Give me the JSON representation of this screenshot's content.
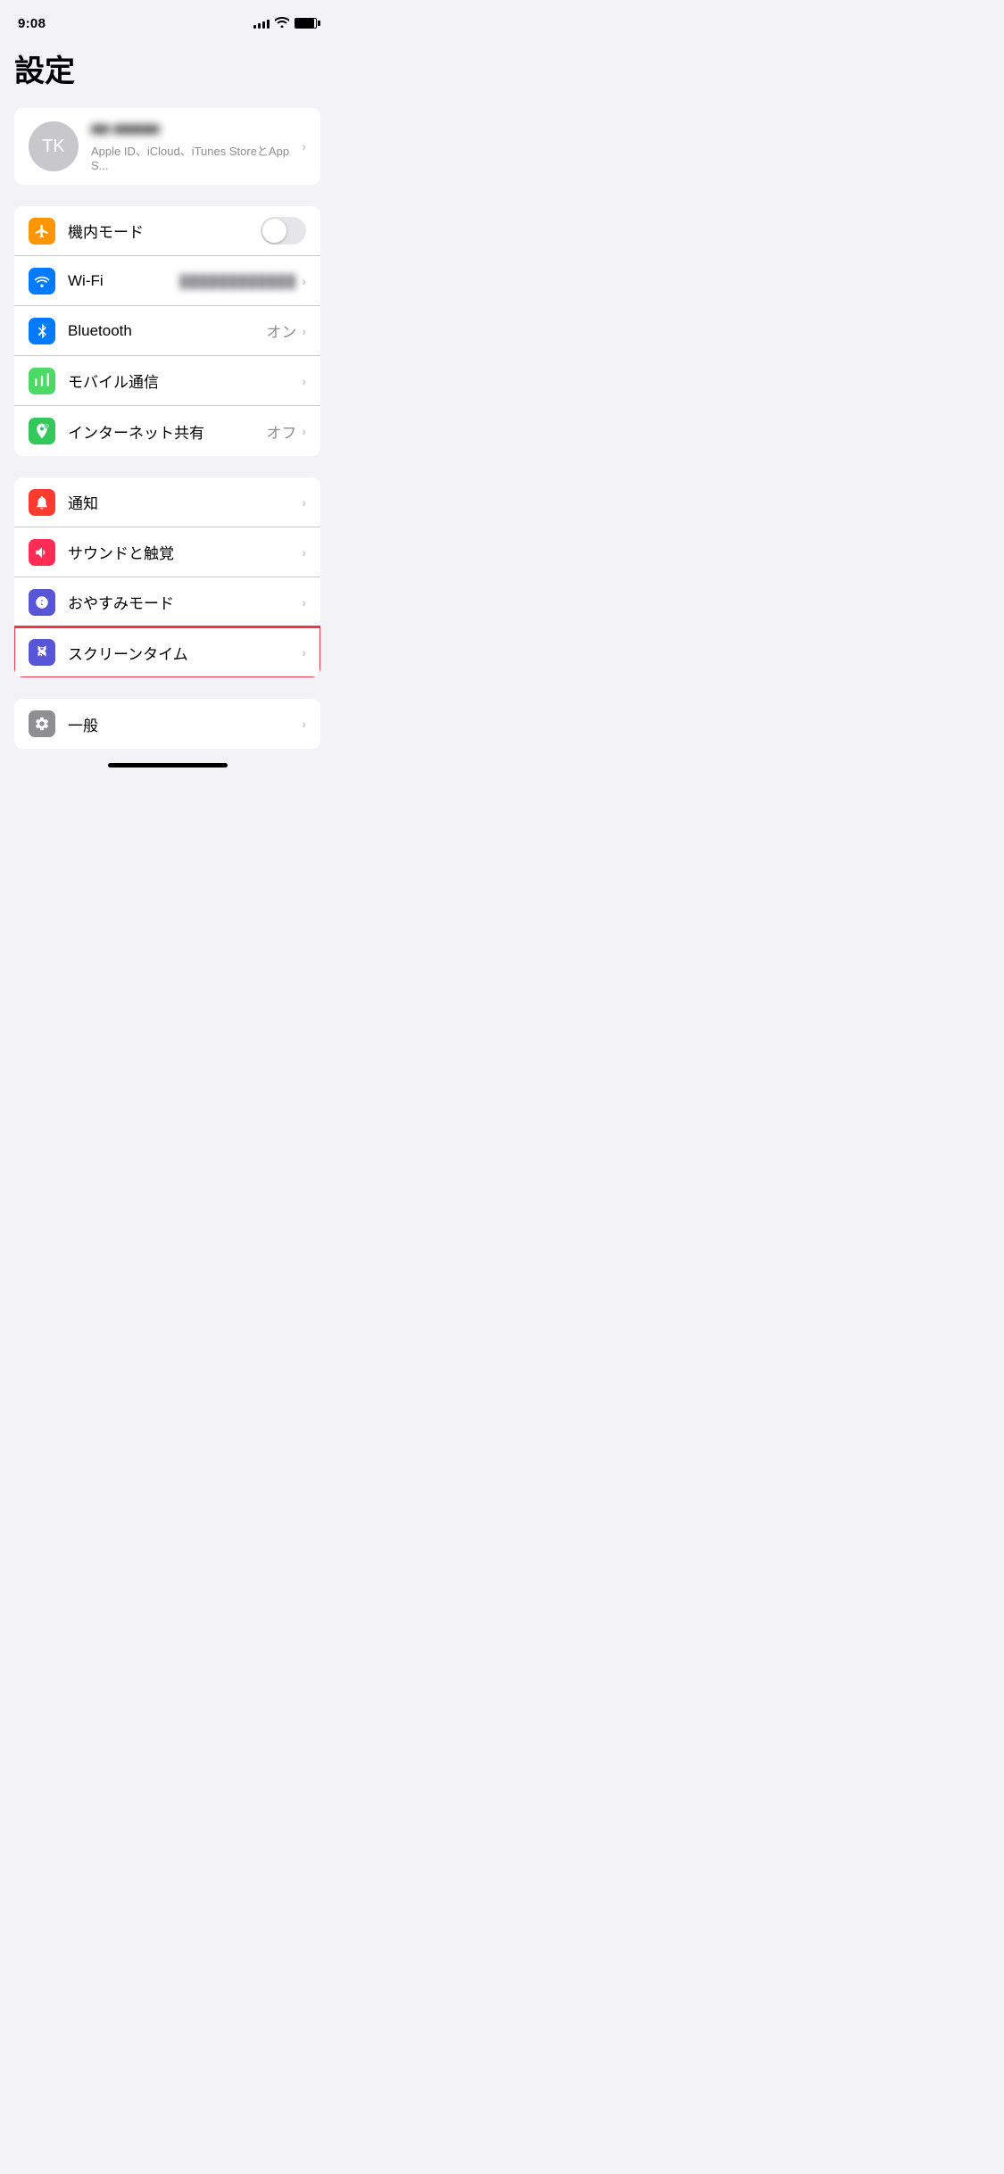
{
  "statusBar": {
    "time": "9:08",
    "signalBars": [
      4,
      6,
      8,
      10,
      12
    ],
    "battery": 90
  },
  "pageTitle": "設定",
  "profile": {
    "initials": "TK",
    "name": "Blurred Name",
    "subtitle": "Apple ID、iCloud、iTunes StoreとApp S..."
  },
  "sections": [
    {
      "id": "connectivity",
      "items": [
        {
          "id": "airplane-mode",
          "label": "機内モード",
          "iconBg": "orange",
          "iconSymbol": "✈",
          "type": "toggle",
          "toggleOn": false
        },
        {
          "id": "wifi",
          "label": "Wi-Fi",
          "iconBg": "blue",
          "iconSymbol": "wifi",
          "type": "value-chevron",
          "value": "blurred"
        },
        {
          "id": "bluetooth",
          "label": "Bluetooth",
          "iconBg": "blue",
          "iconSymbol": "bluetooth",
          "type": "value-chevron",
          "value": "オン"
        },
        {
          "id": "cellular",
          "label": "モバイル通信",
          "iconBg": "green-cellular",
          "iconSymbol": "cellular",
          "type": "chevron"
        },
        {
          "id": "hotspot",
          "label": "インターネット共有",
          "iconBg": "green-hotspot",
          "iconSymbol": "hotspot",
          "type": "value-chevron",
          "value": "オフ"
        }
      ]
    },
    {
      "id": "system",
      "items": [
        {
          "id": "notifications",
          "label": "通知",
          "iconBg": "red",
          "iconSymbol": "notification",
          "type": "chevron"
        },
        {
          "id": "sounds",
          "label": "サウンドと触覚",
          "iconBg": "pink",
          "iconSymbol": "sound",
          "type": "chevron"
        },
        {
          "id": "donotdisturb",
          "label": "おやすみモード",
          "iconBg": "purple-dnd",
          "iconSymbol": "moon",
          "type": "chevron"
        },
        {
          "id": "screentime",
          "label": "スクリーンタイム",
          "iconBg": "purple",
          "iconSymbol": "hourglass",
          "type": "chevron",
          "highlighted": true
        }
      ]
    },
    {
      "id": "general",
      "items": [
        {
          "id": "general-settings",
          "label": "一般",
          "iconBg": "gray",
          "iconSymbol": "gear",
          "type": "chevron"
        }
      ]
    }
  ],
  "labels": {
    "chevron": "›"
  }
}
